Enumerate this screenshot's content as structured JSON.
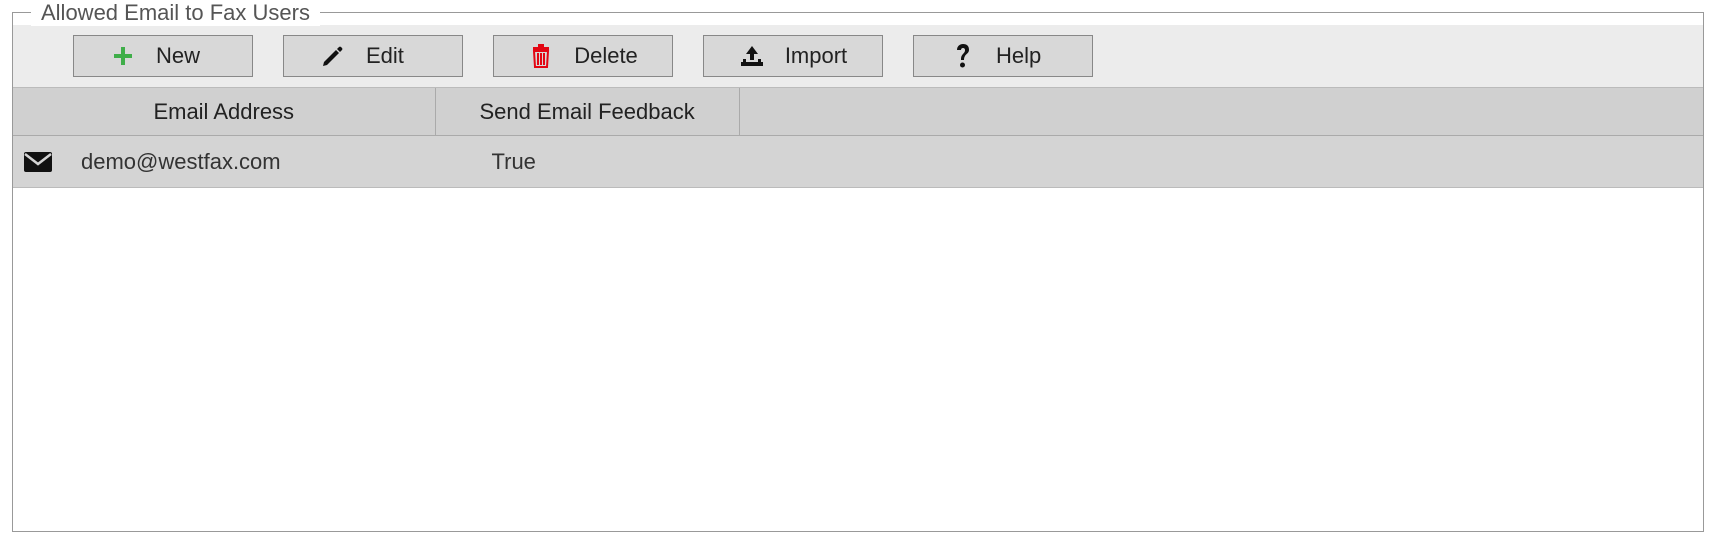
{
  "panel": {
    "title": "Allowed Email to Fax Users"
  },
  "toolbar": {
    "new_label": "New",
    "edit_label": "Edit",
    "delete_label": "Delete",
    "import_label": "Import",
    "help_label": "Help"
  },
  "table": {
    "headers": {
      "email": "Email Address",
      "feedback": "Send Email Feedback"
    },
    "rows": [
      {
        "email": "demo@westfax.com",
        "feedback": "True"
      }
    ]
  }
}
